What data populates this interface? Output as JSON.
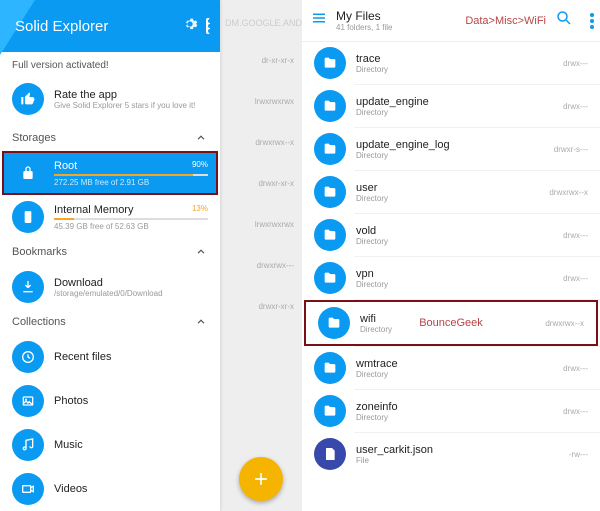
{
  "left": {
    "title": "Solid Explorer",
    "promo": "Full version activated!",
    "rate": {
      "title": "Rate the app",
      "sub": "Give Solid Explorer 5 stars if you love it!"
    },
    "sect_storages": "Storages",
    "root": {
      "name": "Root",
      "pct": "90%",
      "sub": "272.25 MB free of 2.91 GB",
      "fill": 90
    },
    "internal": {
      "name": "Internal Memory",
      "pct": "13%",
      "sub": "45.39 GB free of 52.63 GB",
      "fill": 13
    },
    "sect_bookmarks": "Bookmarks",
    "download": {
      "name": "Download",
      "sub": "/storage/emulated/0/Download"
    },
    "sect_collections": "Collections",
    "recent": "Recent files",
    "photos": "Photos",
    "music": "Music",
    "videos": "Videos"
  },
  "mid": {
    "bg_text": "DM.GOOGLE.AND",
    "perms": [
      "dr-xr-xr-x",
      "lrwxrwxrwx",
      "drwxrwx--x",
      "drwxr-xr-x",
      "lrwxrwxrwx",
      "drwxrwx---",
      "drwxr-xr-x"
    ]
  },
  "right": {
    "title": "My Files",
    "sub": "41 folders, 1 file",
    "breadcrumb": "Data>Misc>WiFi",
    "bounce": "BounceGeek",
    "items": [
      {
        "name": "trace",
        "type": "Directory",
        "perm": "drwx---"
      },
      {
        "name": "update_engine",
        "type": "Directory",
        "perm": "drwx---"
      },
      {
        "name": "update_engine_log",
        "type": "Directory",
        "perm": "drwxr-s---"
      },
      {
        "name": "user",
        "type": "Directory",
        "perm": "drwxrwx--x"
      },
      {
        "name": "vold",
        "type": "Directory",
        "perm": "drwx---"
      },
      {
        "name": "vpn",
        "type": "Directory",
        "perm": "drwx---"
      },
      {
        "name": "wifi",
        "type": "Directory",
        "perm": "drwxrwx--x"
      },
      {
        "name": "wmtrace",
        "type": "Directory",
        "perm": "drwx---"
      },
      {
        "name": "zoneinfo",
        "type": "Directory",
        "perm": "drwx---"
      },
      {
        "name": "user_carkit.json",
        "type": "File",
        "perm": "-rw---"
      }
    ]
  }
}
